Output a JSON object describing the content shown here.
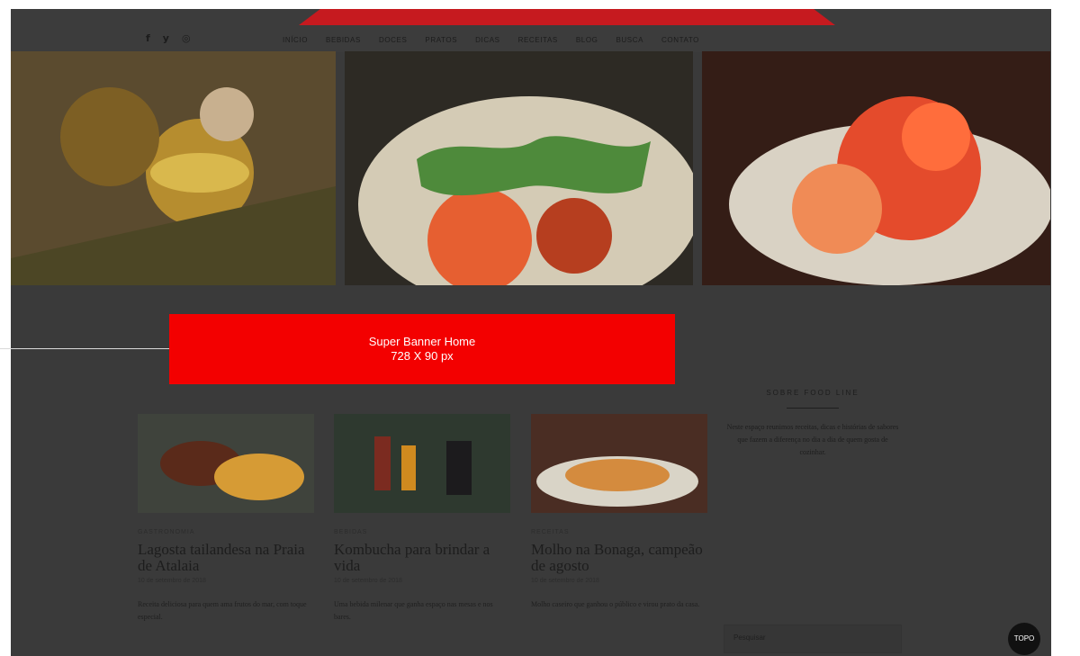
{
  "header": {
    "social_icons": [
      "facebook-icon",
      "twitter-icon",
      "instagram-icon"
    ],
    "social_glyphs": [
      "f",
      "y",
      "◎"
    ],
    "nav_items": [
      "Início",
      "Bebidas",
      "Doces",
      "Pratos",
      "Dicas",
      "Receitas",
      "Blog",
      "Busca",
      "Contato"
    ]
  },
  "banner": {
    "title": "Super Banner Home",
    "size": "728 X 90 px"
  },
  "posts": [
    {
      "category": "Gastronomia",
      "title": "Lagosta tailandesa na Praia de Atalaia",
      "date": "10 de setembro de 2018",
      "excerpt": "Receita deliciosa para quem ama frutos do mar, com toque especial."
    },
    {
      "category": "Bebidas",
      "title": "Kombucha para brindar a vida",
      "date": "10 de setembro de 2018",
      "excerpt": "Uma bebida milenar que ganha espaço nas mesas e nos bares."
    },
    {
      "category": "Receitas",
      "title": "Molho na Bonaga, campeão de agosto",
      "date": "10 de setembro de 2018",
      "excerpt": "Molho caseiro que ganhou o público e virou prato da casa."
    }
  ],
  "sidebar": {
    "title": "Sobre Food Line",
    "text": "Neste espaço reunimos receitas, dicas e histórias de sabores que fazem a diferença no dia a dia de quem gosta de cozinhar."
  },
  "search": {
    "placeholder": "Pesquisar"
  },
  "top_button": {
    "label": "TOPO"
  },
  "colors": {
    "accent": "#c61a1f",
    "banner": "#f30000",
    "overlay": "#3a3a3a"
  }
}
